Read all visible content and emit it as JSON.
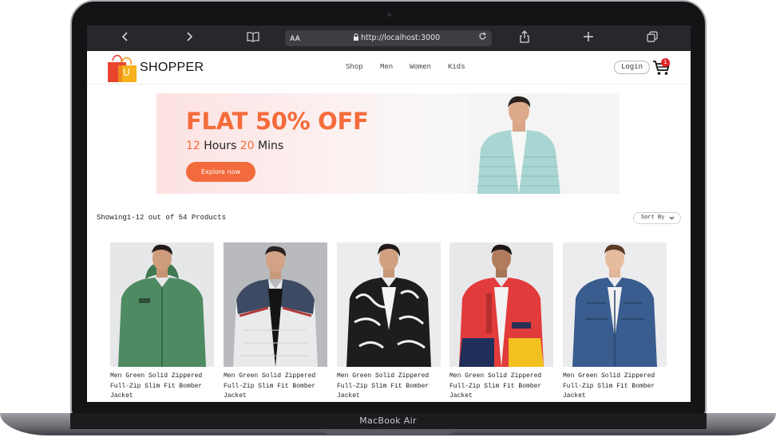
{
  "device": {
    "label": "MacBook Air"
  },
  "browser": {
    "text_size_label": "AA",
    "url": "http://localhost:3000",
    "icons": [
      "back-icon",
      "forward-icon",
      "bookmarks-icon",
      "lock-icon",
      "reload-icon",
      "share-icon",
      "new-tab-icon",
      "tabs-icon"
    ]
  },
  "navbar": {
    "logo_text": "SHOPPER",
    "logo_letter": "U",
    "links": [
      "Shop",
      "Men",
      "Women",
      "Kids"
    ],
    "login_label": "Login",
    "cart_count": "1"
  },
  "hero": {
    "title": "FLAT 50% OFF",
    "hours_value": "12",
    "hours_label": " Hours ",
    "mins_value": "20",
    "mins_label": " Mins",
    "button_label": "Explore now"
  },
  "listing": {
    "showing_text": "Showing1-12 out of 54 Products",
    "sort_label": "Sort By"
  },
  "products": [
    {
      "name": "Men Green Solid Zippered Full-Zip Slim Fit Bomber Jacket"
    },
    {
      "name": "Men Green Solid Zippered Full-Zip Slim Fit Bomber Jacket"
    },
    {
      "name": "Men Green Solid Zippered Full-Zip Slim Fit Bomber Jacket"
    },
    {
      "name": "Men Green Solid Zippered Full-Zip Slim Fit Bomber Jacket"
    },
    {
      "name": "Men Green Solid Zippered Full-Zip Slim Fit Bomber Jacket"
    }
  ],
  "colors": {
    "accent": "#f56b3a",
    "badge": "#e1262b",
    "browser_chrome": "#27282c"
  }
}
